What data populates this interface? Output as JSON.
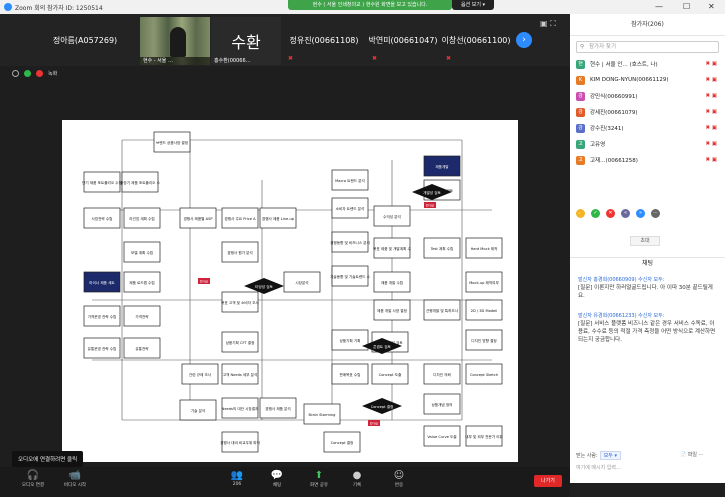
{
  "window": {
    "title": "Zoom 회의 참가자 ID: 1250514",
    "share_banner": "현수 ( 서울 인쇄창의교 ) 현수원 화면을 보고 있습니다.",
    "stop_share": "옵션 보기 ▾"
  },
  "participants_strip": [
    {
      "name": "정아름(A057269)"
    },
    {
      "name": "현수 - 서울 …"
    },
    {
      "name": "수환",
      "sub": "홍수환(00066…"
    },
    {
      "name": "정유진(00661108)"
    },
    {
      "name": "박연미(00661047)"
    },
    {
      "name": "이창선(00661100)"
    }
  ],
  "status": {
    "rec_label": "녹화"
  },
  "flowchart": {
    "nodes": [
      "브랜드 상품사양 결정",
      "단기 제품 포트폴리오 수립",
      "중장기 제품 포트폴리오 수립",
      "사업전략 수립",
      "라인업 계획 수립",
      "모델 계획 수립",
      "경쟁사 제품별 ASP",
      "경쟁사 주요 Price Action 동향",
      "경쟁사 제품 Line-up 분석",
      "경쟁사 원가 분석",
      "제품 로드맵 수립",
      "마이너 제품 세트",
      "가격운영 전략 수립",
      "가격전략",
      "유통운영 전략 수립",
      "유통전략",
      "목표 고객 및 소비자 조사",
      "상품기획 CFT 결정",
      "고객 Needs 세부 분석",
      "관련 규제 조사",
      "기술 분석",
      "Needs의 대안 시장결과",
      "경쟁사 제품 분석",
      "경쟁사 대비 비교우위 파악",
      "시장분석",
      "Macro 트렌드 분석",
      "소비자 트렌드 분석",
      "경쟁동향 및 비즈니스 분석",
      "기술동향 및 기술트렌드 수립",
      "개발 가능 검토",
      "수익성 분석",
      "목표 제품 및 개발계획 수립",
      "Test 계획 수립",
      "제품 개발 수립",
      "Hard Mock 제작",
      "Mock-up 제작여부",
      "제품 개발 사양 결정",
      "선행개발 및 특허조사",
      "2D / 3D Modeling",
      "디자인 방향 결정",
      "디자인 의뢰",
      "Concept Sketch",
      "Brain Storming",
      "Concept 결정",
      "Concept 도출",
      "상품개념 정의",
      "Value Curve 도출",
      "내부 및 외부 전문가 리뷰",
      "상품기획 기획",
      "판매목표 수립",
      "개발 실현성 검토",
      "제품개발"
    ],
    "decisions": [
      "타당성 검토",
      "개발성 검토",
      "콘셉트 검토",
      "Concept 결정"
    ],
    "drop_labels": [
      "Drop",
      "Drop",
      "Drop"
    ]
  },
  "toast": "오디오에 연결하려면 클릭",
  "toolbar": {
    "items": [
      "오디오 연결",
      "비디오 시작",
      "참가자 206",
      "채팅",
      "화면 공유",
      "기록",
      "반응"
    ],
    "count": "206",
    "end": "나가기"
  },
  "sidebar": {
    "header": "참가자(206)",
    "search_placeholder": "참가자 찾기",
    "participants": [
      {
        "initial": "현",
        "name": "현수 | 서울 인… (호스트, 나)",
        "color": "#3aa57a"
      },
      {
        "initial": "K",
        "name": "KIM DONG-NYUN(00661129)",
        "color": "#e57b27"
      },
      {
        "initial": "강",
        "name": "강민식(00660991)",
        "color": "#c94fb0"
      },
      {
        "initial": "강",
        "name": "강세진(00661079)",
        "color": "#e05a2a"
      },
      {
        "initial": "강",
        "name": "강수진(3241)",
        "color": "#5a6fc9"
      },
      {
        "initial": "고",
        "name": "고유영",
        "color": "#3aa57a"
      },
      {
        "initial": "고",
        "name": "고재…(00661258)",
        "color": "#e57b27"
      }
    ],
    "reactions": [
      "손들기",
      "예",
      "아니오",
      "느리게",
      "빠르게",
      "자리비움"
    ],
    "invite_label": "초대",
    "chat_header": "채팅",
    "messages": [
      {
        "from": "발신자 홍경희(00660909) 수신자 모두:",
        "text": "[질문] 이론지만 하러얼굴드립니다. 아 이따 30분 끝드릴게요."
      },
      {
        "from": "발신자 유경희(00661233) 수신자 모두:",
        "text": "[질문] 서비스 플랫폼 비즈니스 같은 경우 서비스 수독료, 이용료, 수수료 등의 적절 가격 측정을 어떤 방식으로 계산하면 되는지 궁금합니다."
      }
    ],
    "send_to_label": "받는 사람:",
    "send_to_value": "모두 ▾",
    "chat_placeholder": "여기에 메시지 입력...",
    "file_label": "파일"
  }
}
